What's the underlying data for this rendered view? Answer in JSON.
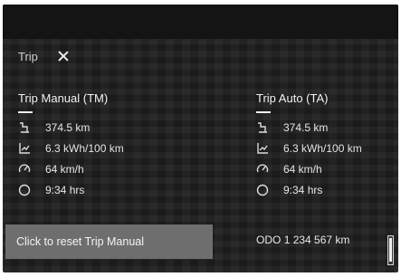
{
  "header": {
    "title": "Trip"
  },
  "trip_manual": {
    "heading": "Trip Manual (TM)",
    "rows": [
      {
        "icon": "distance-icon",
        "value": "374.5 km"
      },
      {
        "icon": "energy-consumption-icon",
        "value": "6.3 kWh/100 km"
      },
      {
        "icon": "speed-gauge-icon",
        "value": "64 km/h"
      },
      {
        "icon": "clock-icon",
        "value": "9:34 hrs"
      }
    ]
  },
  "trip_auto": {
    "heading": "Trip Auto (TA)",
    "rows": [
      {
        "icon": "distance-icon",
        "value": "374.5 km"
      },
      {
        "icon": "energy-consumption-icon",
        "value": "6.3 kWh/100 km"
      },
      {
        "icon": "speed-gauge-icon",
        "value": "64 km/h"
      },
      {
        "icon": "clock-icon",
        "value": "9:34 hrs"
      }
    ]
  },
  "footer": {
    "reset_label": "Click to reset Trip Manual",
    "odo_label": "ODO",
    "odo_value": "1 234 567 km"
  }
}
